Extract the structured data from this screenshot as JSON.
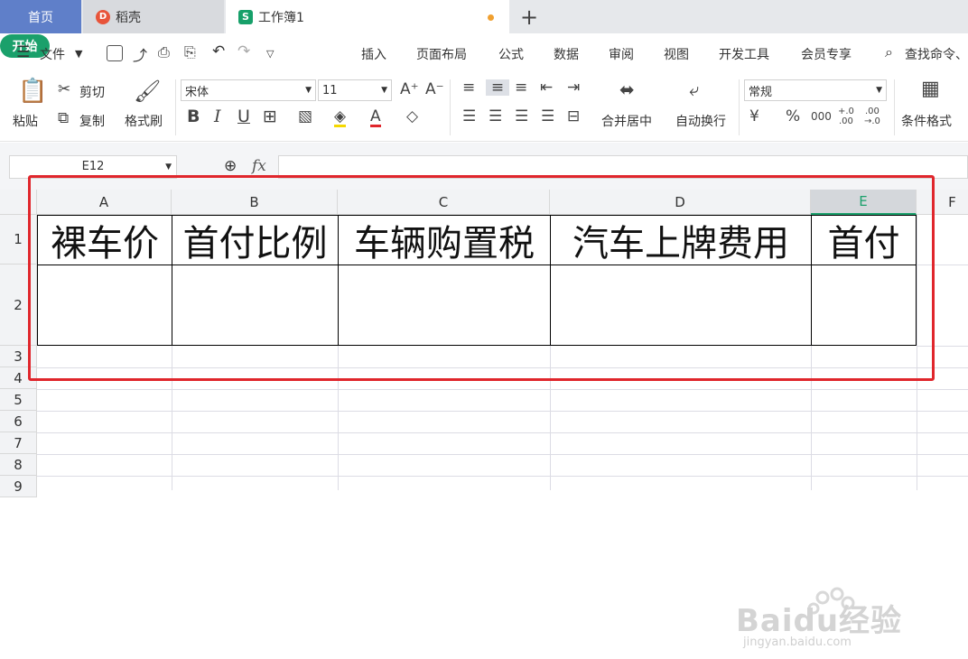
{
  "tabs": [
    {
      "label": "首页"
    },
    {
      "label": "稻壳",
      "icon": "daoke-logo"
    },
    {
      "label": "工作簿1",
      "icon": "sheet-logo"
    }
  ],
  "menu": {
    "file": "文件",
    "items": [
      "开始",
      "插入",
      "页面布局",
      "公式",
      "数据",
      "审阅",
      "视图",
      "开发工具",
      "会员专享"
    ],
    "search_placeholder": "查找命令、"
  },
  "ribbon": {
    "paste": "粘贴",
    "cut": "剪切",
    "copy": "复制",
    "format_painter": "格式刷",
    "font_name": "宋体",
    "font_size": "11",
    "merge_center": "合并居中",
    "wrap_text": "自动换行",
    "number_format": "常规",
    "conditional_format": "条件格式",
    "currency_symbol": "¥"
  },
  "formula_bar": {
    "name_box": "E12",
    "fx": "fx",
    "formula": ""
  },
  "sheet": {
    "columns": [
      "A",
      "B",
      "C",
      "D",
      "E",
      "F"
    ],
    "selected_column": "E",
    "rows": [
      "1",
      "2",
      "3",
      "4",
      "5",
      "6",
      "7",
      "8",
      "9"
    ],
    "header_cells": [
      "裸车价",
      "首付比例",
      "车辆购置税",
      "汽车上牌费用",
      "首付"
    ]
  },
  "watermark": {
    "brand": "Baidu经验",
    "url": "jingyan.baidu.com"
  },
  "colors": {
    "accent_green": "#1aa06b",
    "home_tab": "#5f7fc9",
    "highlight_red": "#e0262c",
    "modified_dot": "#f0a030"
  }
}
